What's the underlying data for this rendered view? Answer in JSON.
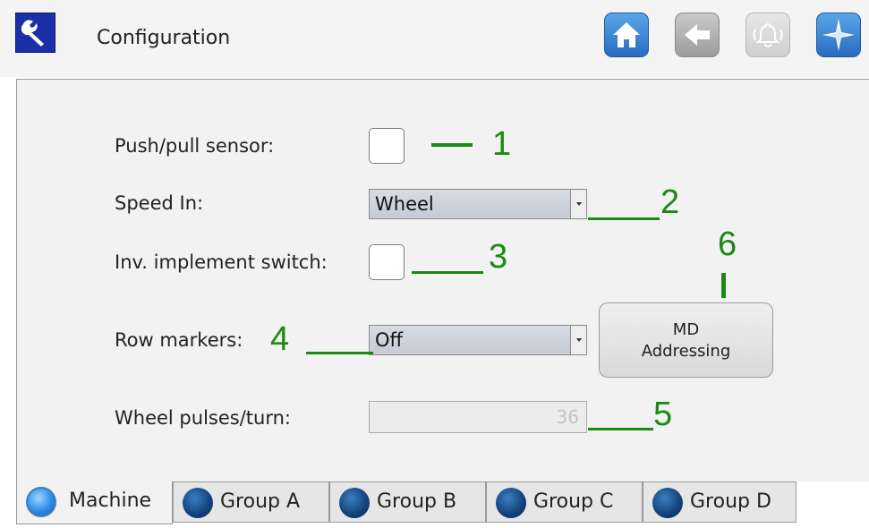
{
  "header": {
    "title": "Configuration",
    "icons": {
      "app": "wrench-icon",
      "home": "home-icon",
      "back": "back-arrow-icon",
      "alarm": "alarm-bell-icon",
      "nav": "compass-icon"
    }
  },
  "form": {
    "push_pull_label": "Push/pull sensor:",
    "speed_in_label": "Speed In:",
    "speed_in_value": "Wheel",
    "inv_switch_label": "Inv. implement switch:",
    "row_markers_label": "Row markers:",
    "row_markers_value": "Off",
    "wheel_pulses_label": "Wheel pulses/turn:",
    "wheel_pulses_value": "36",
    "md_button": {
      "line1": "MD",
      "line2": "Addressing"
    }
  },
  "annotations": [
    "1",
    "2",
    "3",
    "4",
    "5",
    "6"
  ],
  "tabs": [
    {
      "label": "Machine",
      "active": true
    },
    {
      "label": "Group A",
      "active": false
    },
    {
      "label": "Group B",
      "active": false
    },
    {
      "label": "Group C",
      "active": false
    },
    {
      "label": "Group D",
      "active": false
    }
  ],
  "colors": {
    "annotation": "#1a8a12",
    "accent": "#2a6cc0"
  }
}
